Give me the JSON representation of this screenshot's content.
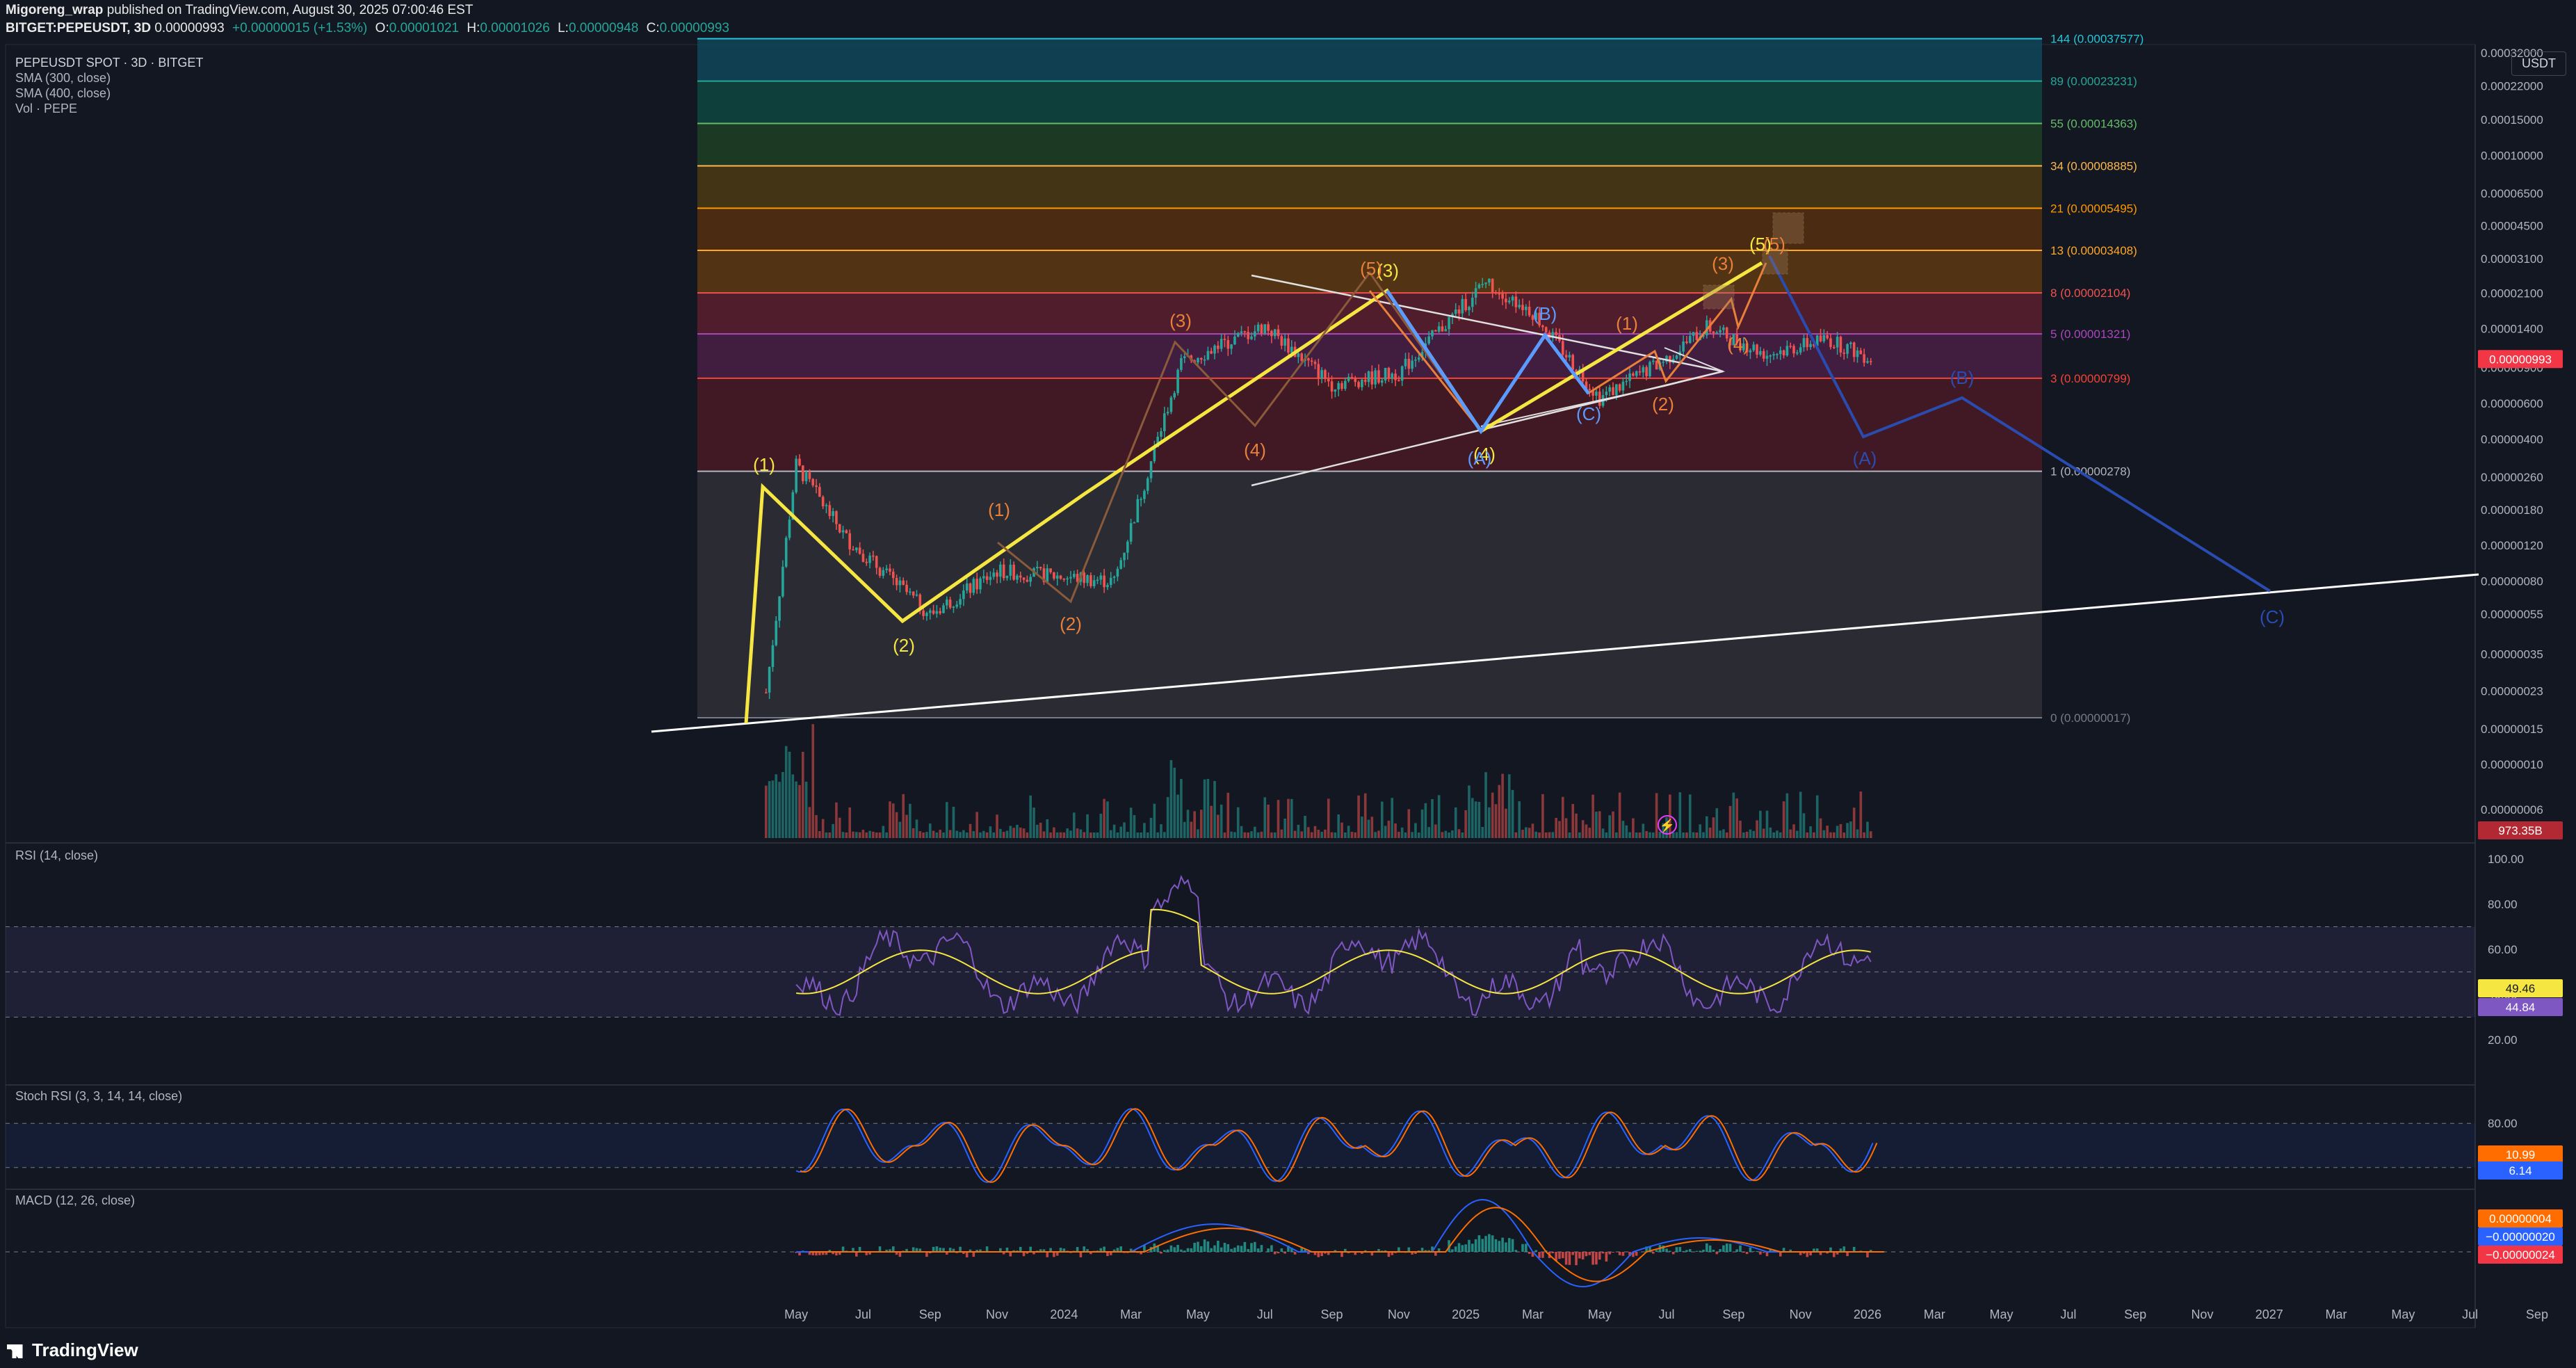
{
  "header": {
    "publisher": "Migoreng_wrap",
    "published": "published on TradingView.com, August 30, 2025 07:00:46 EST",
    "symbol": "BITGET:PEPEUSDT, 3D",
    "price": "0.00000993",
    "change": "+0.00000015 (+1.53%)",
    "o_label": "O:",
    "o": "0.00001021",
    "h_label": "H:",
    "h": "0.00001026",
    "l_label": "L:",
    "l": "0.00000948",
    "c_label": "C:",
    "c": "0.00000993"
  },
  "legend": {
    "title": "PEPEUSDT SPOT · 3D · BITGET",
    "sma300": "SMA (300, close)",
    "sma400": "SMA (400, close)",
    "vol": "Vol · PEPE",
    "rsi": "RSI (14, close)",
    "stoch": "Stoch RSI (3, 3, 14, 14, close)",
    "macd": "MACD (12, 26, close)"
  },
  "currency_button": "USDT",
  "brand": "TradingView",
  "colors": {
    "bg": "#131722",
    "up": "#26a69a",
    "down": "#ef5350",
    "wave_yellow": "#f5e642",
    "wave_orange": "#e8803a",
    "wave_blue": "#2962ff",
    "price_badge": "#f23645"
  },
  "chart_data": {
    "type": "line",
    "title": "PEPEUSDT SPOT · 3D · BITGET",
    "log_scale": true,
    "grid": false,
    "price_axis_ticks": [
      "0.00032000",
      "0.00022000",
      "0.00015000",
      "0.00010000",
      "0.00006500",
      "0.00004500",
      "0.00003100",
      "0.00002100",
      "0.00001400",
      "0.00000900",
      "0.00000600",
      "0.00000400",
      "0.00000260",
      "0.00000180",
      "0.00000120",
      "0.00000080",
      "0.00000055",
      "0.00000035",
      "0.00000023",
      "0.00000015",
      "0.00000010",
      "0.00000006"
    ],
    "time_axis_ticks": [
      "May",
      "Jul",
      "Sep",
      "Nov",
      "2024",
      "Mar",
      "May",
      "Jul",
      "Sep",
      "Nov",
      "2025",
      "Mar",
      "May",
      "Jul",
      "Sep",
      "Nov",
      "2026",
      "Mar",
      "May",
      "Jul",
      "Sep",
      "Nov",
      "2027",
      "Mar",
      "May",
      "Jul",
      "Sep"
    ],
    "fib_levels": [
      {
        "ratio": "144",
        "value": "0.00037577",
        "color": "#26c6da"
      },
      {
        "ratio": "89",
        "value": "0.00023231",
        "color": "#26a69a"
      },
      {
        "ratio": "55",
        "value": "0.00014363",
        "color": "#66bb6a"
      },
      {
        "ratio": "34",
        "value": "0.00008885",
        "color": "#ffb74d"
      },
      {
        "ratio": "21",
        "value": "0.00005495",
        "color": "#ff9800"
      },
      {
        "ratio": "13",
        "value": "0.00003408",
        "color": "#ffa726"
      },
      {
        "ratio": "8",
        "value": "0.00002104",
        "color": "#ef5350"
      },
      {
        "ratio": "5",
        "value": "0.00001321",
        "color": "#ab47bc"
      },
      {
        "ratio": "3",
        "value": "0.00000799",
        "color": "#f44336"
      },
      {
        "ratio": "1",
        "value": "0.00000278",
        "color": "#b2b5be"
      },
      {
        "ratio": "0",
        "value": "0.00000017",
        "color": "#787b86"
      }
    ],
    "price_badge": "0.00000993",
    "volume_badge": "973.35B",
    "wave_labels": {
      "yellow": [
        "(1)",
        "(2)",
        "(3)",
        "(4)",
        "(5)"
      ],
      "orange": [
        "(1)",
        "(2)",
        "(3)",
        "(4)",
        "(5)",
        "(1)",
        "(2)",
        "(3)",
        "(4)",
        "(5)"
      ],
      "blue": [
        "(A)",
        "(B)",
        "(C)",
        "(A)",
        "(B)",
        "(C)"
      ]
    },
    "rsi": {
      "ticks": [
        "100.00",
        "80.00",
        "60.00",
        "40.00",
        "20.00"
      ],
      "value": "49.46",
      "ma": "44.84"
    },
    "stoch_rsi": {
      "ticks": [
        "80.00",
        "40.00"
      ],
      "k": "10.99",
      "d": "6.14"
    },
    "macd": {
      "macd": "0.00000004",
      "signal": "−0.00000020",
      "hist": "−0.00000024"
    }
  }
}
